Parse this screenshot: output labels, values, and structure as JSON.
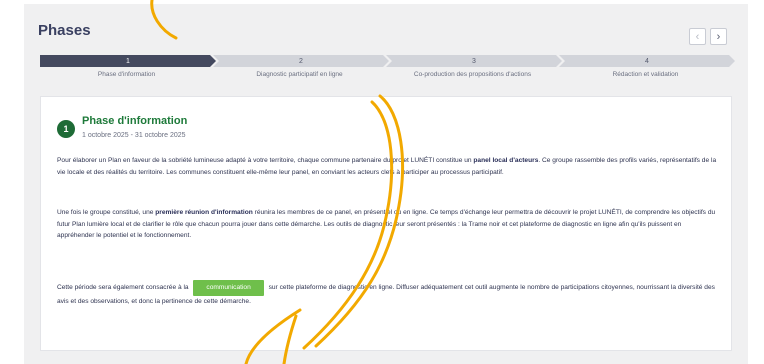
{
  "header": {
    "title": "Phases"
  },
  "nav": {
    "prev_icon": "chevron-left-icon",
    "next_icon": "chevron-right-icon",
    "prev_glyph": "‹",
    "next_glyph": "›"
  },
  "steps": [
    {
      "number": "1",
      "label": "Phase d'information",
      "active": true
    },
    {
      "number": "2",
      "label": "Diagnostic participatif en ligne",
      "active": false
    },
    {
      "number": "3",
      "label": "Co-production des propositions d'actions",
      "active": false
    },
    {
      "number": "4",
      "label": "Rédaction et validation",
      "active": false
    }
  ],
  "phase": {
    "number": "1",
    "title": "Phase d'information",
    "dates": "1 octobre 2025 - 31 octobre 2025",
    "p1_a": "Pour élaborer un Plan en faveur de la sobriété lumineuse adapté à votre territoire, chaque commune partenaire du projet LUNÉTI constitue un ",
    "p1_b": "panel local d'acteurs",
    "p1_c": ". Ce groupe rassemble des profils variés, représentatifs de la vie locale et des réalités du territoire. Les communes constituent elle-même leur panel, en conviant les acteurs clefs à participer au processus participatif.",
    "p2_a": "Une fois le groupe constitué, une ",
    "p2_b": "première réunion d'information",
    "p2_c": " réunira les membres de ce panel, en présentiel ou en ligne. Ce temps d'échange leur permettra de découvrir le projet LUNÉTI, de comprendre les objectifs du futur Plan lumière local et de clarifier le rôle que chacun pourra jouer dans cette démarche. Les outils de diagnostic leur seront présentés : la Trame noir et cet plateforme de diagnostic en ligne afin qu'ils puissent en appréhender le potentiel et le fonctionnement.",
    "p3_a": "Cette période sera également consacrée à la ",
    "p3_highlight": "communication",
    "p3_c": " sur cette plateforme de diagnostic en ligne. Diffuser adéquatement cet outil augmente le nombre de participations citoyennes, nourrissant la diversité des avis et des observations, et donc la pertinence de cette démarche."
  },
  "colors": {
    "accent_green": "#1e7a3a",
    "highlight_green": "#6fbf4b",
    "active_step": "#44495f",
    "annotation": "#f2a900"
  }
}
